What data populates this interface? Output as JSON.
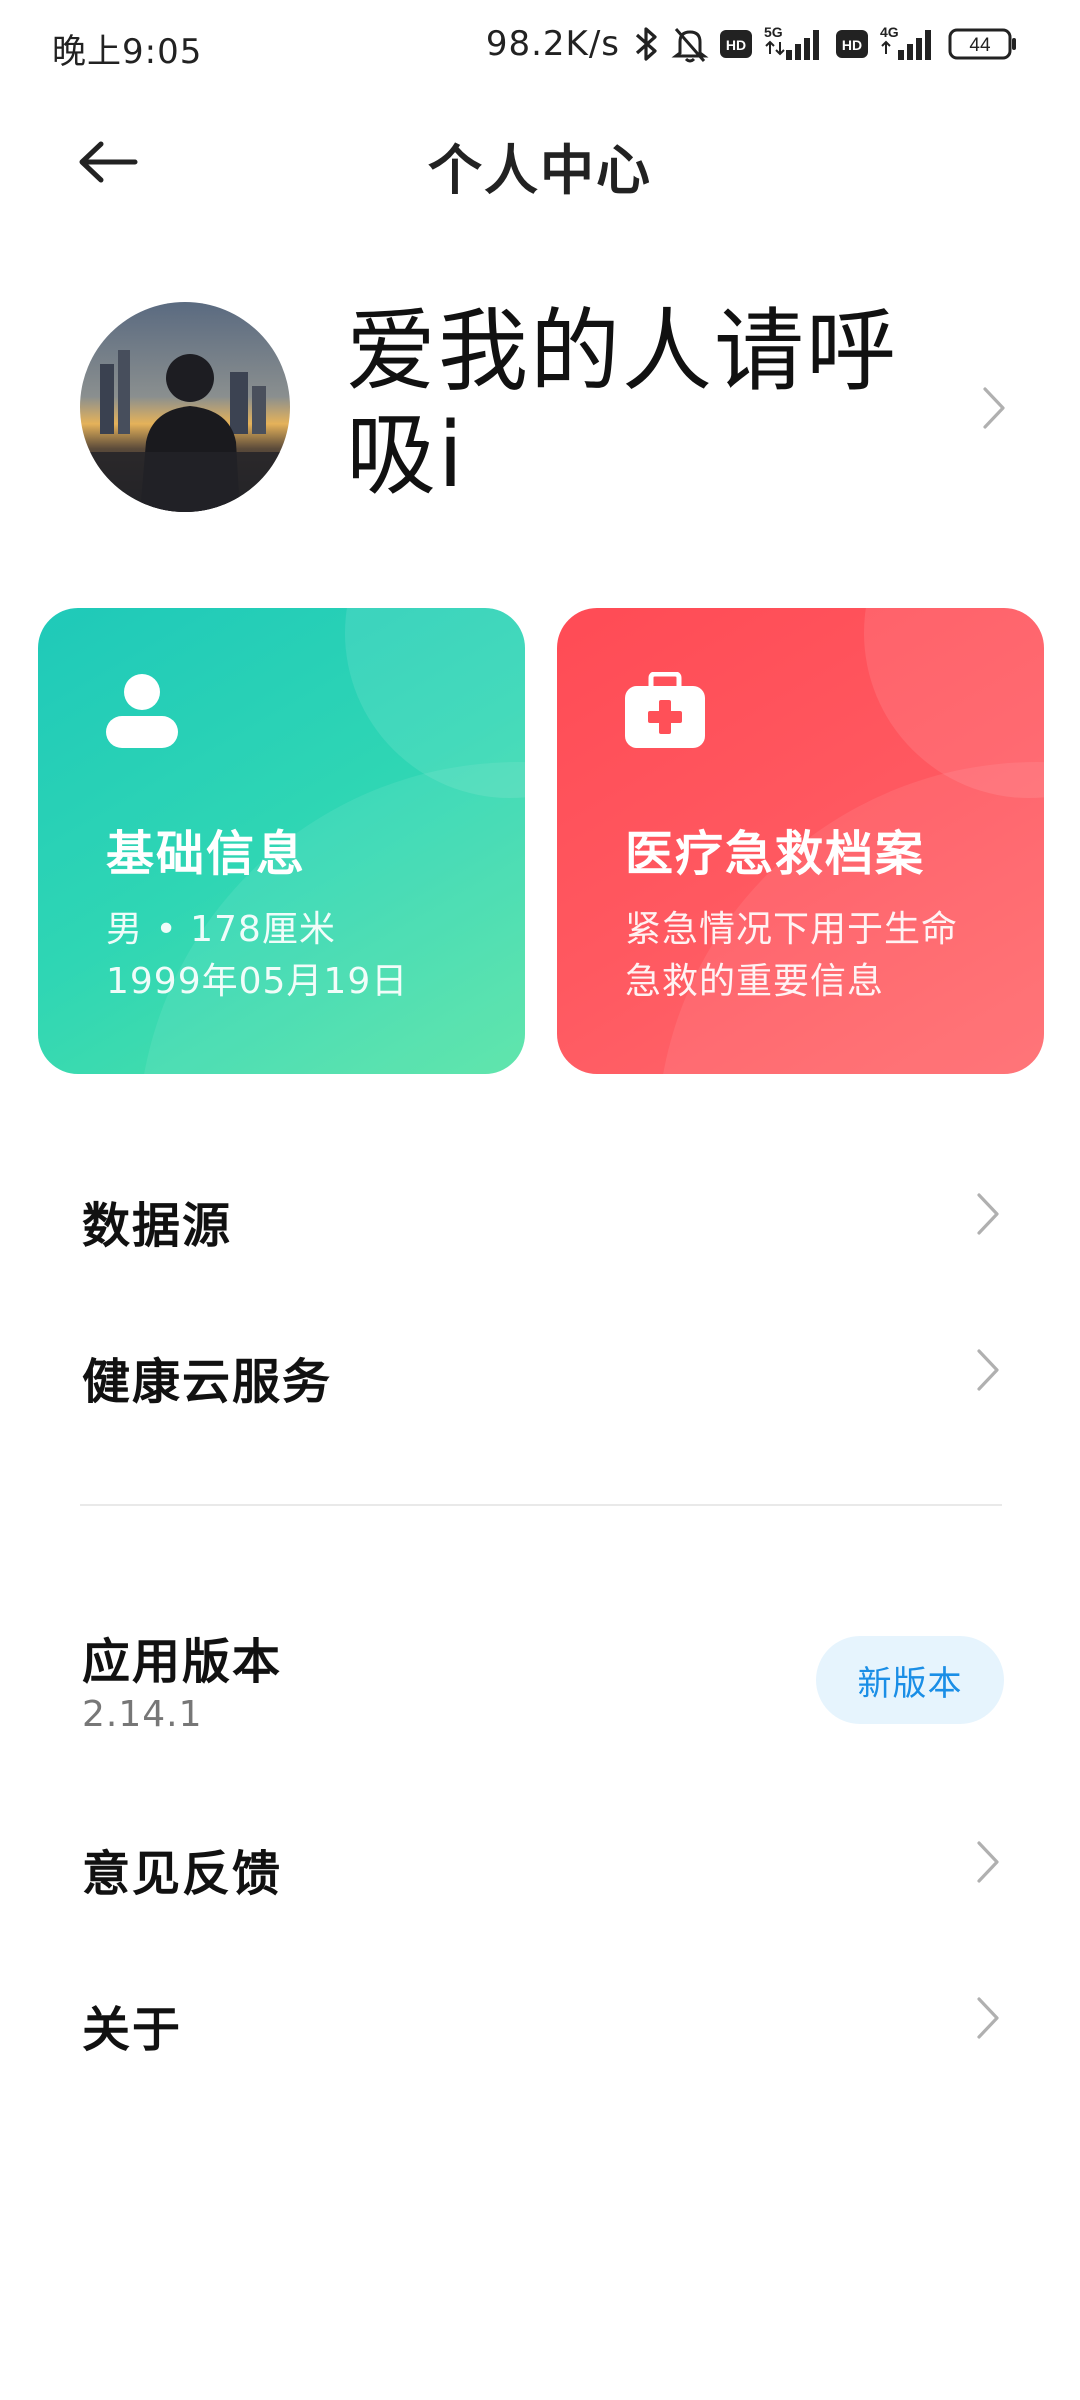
{
  "status_bar": {
    "time": "晚上9:05",
    "network_speed": "98.2K/s",
    "battery_level": "44",
    "icons": [
      "bluetooth-icon",
      "silent-bell-icon",
      "hd-icon",
      "5g-signal-icon",
      "hd-icon",
      "4g-signal-icon",
      "battery-icon"
    ],
    "label_5g": "5G",
    "label_4g": "4G",
    "label_hd": "HD"
  },
  "header": {
    "title": "个人中心",
    "back_icon": "arrow-left-icon"
  },
  "profile": {
    "name": "爱我的人请呼吸i",
    "avatar_icon": "avatar-photo",
    "chevron_icon": "chevron-right-icon"
  },
  "cards": {
    "basic_info": {
      "icon": "person-icon",
      "title": "基础信息",
      "line1": "男 • 178厘米",
      "line2": "1999年05月19日",
      "color": "#2fd6b4"
    },
    "medical_record": {
      "icon": "first-aid-kit-icon",
      "title": "医疗急救档案",
      "line1": "紧急情况下用于生命",
      "line2": "急救的重要信息",
      "color": "#ff5860"
    }
  },
  "menu": {
    "data_source": "数据源",
    "health_cloud": "健康云服务",
    "app_version_label": "应用版本",
    "app_version_value": "2.14.1",
    "new_version_button": "新版本",
    "feedback": "意见反馈",
    "about": "关于"
  },
  "colors": {
    "accent_blue": "#1a8ee6",
    "chevron": "#b0b0b0"
  }
}
